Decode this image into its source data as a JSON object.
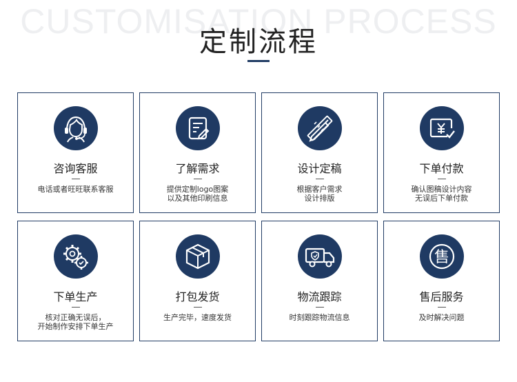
{
  "header": {
    "watermark": "CUSTOMISATION PROCESS",
    "title": "定制流程"
  },
  "steps": [
    {
      "title": "咨询客服",
      "desc": "电话或者旺旺联系客服",
      "icon": "customer-service-icon"
    },
    {
      "title": "了解需求",
      "desc": "提供定制logo图案\n以及其他印刷信息",
      "icon": "document-edit-icon"
    },
    {
      "title": "设计定稿",
      "desc": "根据客户需求\n设计排版",
      "icon": "pencil-ruler-icon"
    },
    {
      "title": "下单付款",
      "desc": "确认图稿设计内容\n无误后下单付款",
      "icon": "yen-payment-icon"
    },
    {
      "title": "下单生产",
      "desc": "核对正确无误后，\n开始制作安排下单生产",
      "icon": "gears-icon"
    },
    {
      "title": "打包发货",
      "desc": "生产完毕，速度发货",
      "icon": "package-box-icon"
    },
    {
      "title": "物流跟踪",
      "desc": "时刻跟踪物流信息",
      "icon": "delivery-truck-icon"
    },
    {
      "title": "售后服务",
      "desc": "及时解决问题",
      "icon": "after-sales-icon"
    }
  ],
  "colors": {
    "accent": "#1f3a63",
    "border": "#1f3a63",
    "watermark": "#eeeff1"
  }
}
